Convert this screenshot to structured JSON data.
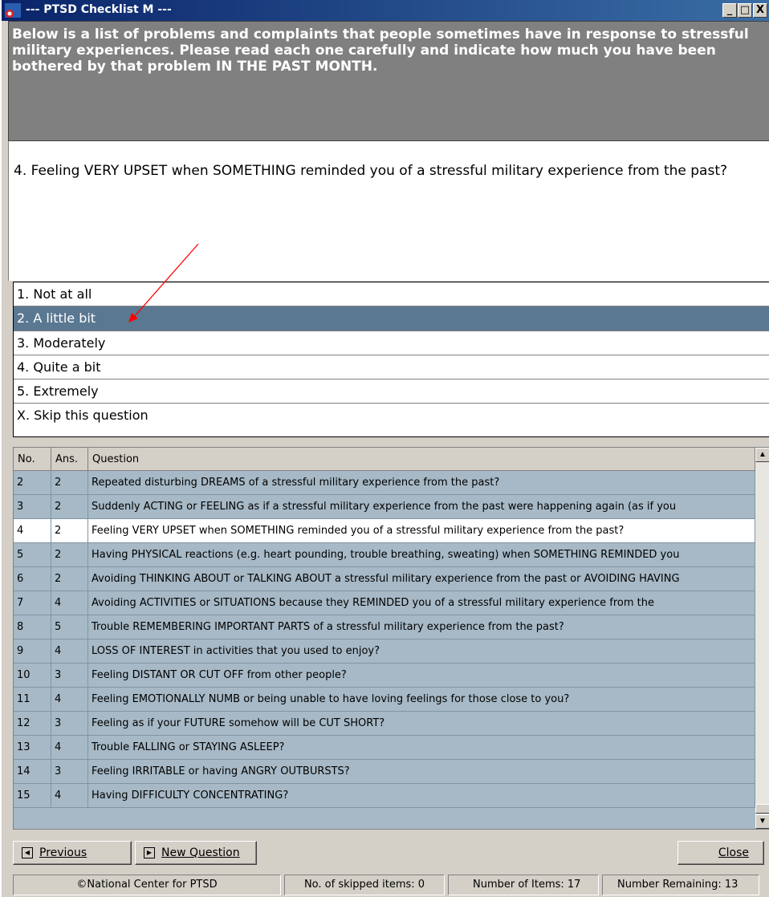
{
  "window": {
    "title": "--- PTSD Checklist M ---",
    "controls": [
      "_",
      "□",
      "X"
    ]
  },
  "instructions": "Below is a list of problems and complaints that people sometimes have in response to stressful military experiences. Please read each one carefully and indicate how much you have been bothered by that problem IN THE PAST MONTH.",
  "question": "4.  Feeling VERY UPSET when SOMETHING reminded you of a stressful military experience from the past?",
  "options": [
    "1. Not at all",
    "2. A little bit",
    "3. Moderately",
    "4. Quite a bit",
    "5. Extremely",
    "X. Skip this question"
  ],
  "selected_option": "2. A little bit",
  "grid": {
    "headers": {
      "no": "No.",
      "ans": "Ans.",
      "question": "Question"
    },
    "rows": [
      {
        "no": "2",
        "ans": "2",
        "q": "Repeated disturbing DREAMS of a stressful military experience from the past?"
      },
      {
        "no": "3",
        "ans": "2",
        "q": "Suddenly ACTING or FEELING as if a stressful military experience from the past were happening again (as if you"
      },
      {
        "no": "4",
        "ans": "2",
        "q": "Feeling VERY UPSET when SOMETHING reminded you of a stressful military experience from the past?"
      },
      {
        "no": "5",
        "ans": "2",
        "q": "Having PHYSICAL reactions (e.g. heart pounding, trouble breathing, sweating) when SOMETHING REMINDED you"
      },
      {
        "no": "6",
        "ans": "2",
        "q": "Avoiding THINKING ABOUT or TALKING ABOUT a stressful military experience from the past or AVOIDING HAVING"
      },
      {
        "no": "7",
        "ans": "4",
        "q": "Avoiding ACTIVITIES or SITUATIONS because they REMINDED you of a stressful military experience from the"
      },
      {
        "no": "8",
        "ans": "5",
        "q": "Trouble REMEMBERING IMPORTANT PARTS of a stressful military experience from the past?"
      },
      {
        "no": "9",
        "ans": "4",
        "q": "LOSS OF INTEREST in activities that you used to enjoy?"
      },
      {
        "no": "10",
        "ans": "3",
        "q": "Feeling DISTANT OR CUT OFF from other people?"
      },
      {
        "no": "11",
        "ans": "4",
        "q": "Feeling EMOTIONALLY NUMB or being unable to have loving feelings for those close to you?"
      },
      {
        "no": "12",
        "ans": "3",
        "q": "Feeling as if your FUTURE somehow will be CUT SHORT?"
      },
      {
        "no": "13",
        "ans": "4",
        "q": "Trouble FALLING or STAYING ASLEEP?"
      },
      {
        "no": "14",
        "ans": "3",
        "q": "Feeling IRRITABLE or having ANGRY OUTBURSTS?"
      },
      {
        "no": "15",
        "ans": "4",
        "q": "Having DIFFICULTY CONCENTRATING?"
      }
    ],
    "current_no": "4"
  },
  "buttons": {
    "previous": "Previous",
    "new_question": "New Question",
    "close": "Close"
  },
  "status": {
    "copyright": "©National Center for PTSD",
    "skipped": "No. of skipped items: 0",
    "items": "Number of Items:  17",
    "remaining": "Number Remaining:  13"
  },
  "colors": {
    "title_bar": "#0a246a",
    "selected_option": "#5a7891",
    "grid_background": "#a7b9c6",
    "annotation_arrow": "#ff0000"
  }
}
